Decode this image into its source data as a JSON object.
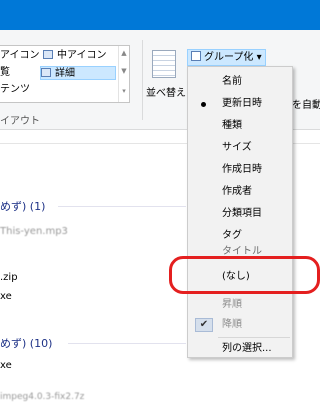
{
  "ribbon": {
    "layout": {
      "items": [
        {
          "label": "アイコン"
        },
        {
          "label": "中アイコン"
        },
        {
          "label": "覧"
        },
        {
          "label": "詳細"
        },
        {
          "label": "テンツ"
        }
      ],
      "group_label": "イアウト"
    },
    "current_view": {
      "sort_label": "並べ替え",
      "group_button_label": "グループ化",
      "autofit_label": "を自動"
    }
  },
  "file_list": {
    "groups": [
      {
        "header": "めず) (1)",
        "files": [
          "This-yen.mp3"
        ]
      },
      {
        "header": "",
        "files": [
          ".zip",
          "xe"
        ]
      },
      {
        "header": "めず) (10)",
        "files": [
          "xe",
          "impeg4.0.3-fix2.7z"
        ]
      }
    ]
  },
  "group_by_menu": {
    "items": [
      {
        "label": "名前"
      },
      {
        "label": "更新日時"
      },
      {
        "label": "種類"
      },
      {
        "label": "サイズ"
      },
      {
        "label": "作成日時"
      },
      {
        "label": "作成者"
      },
      {
        "label": "分類項目"
      },
      {
        "label": "タグ"
      },
      {
        "label": "タイトル"
      },
      {
        "label": "(なし)"
      },
      {
        "label": "昇順"
      },
      {
        "label": "降順"
      },
      {
        "label": "列の選択..."
      }
    ]
  },
  "colors": {
    "titlebar": "#0078d7",
    "annotation": "#e41f1f",
    "selection": "#cce8ff"
  }
}
